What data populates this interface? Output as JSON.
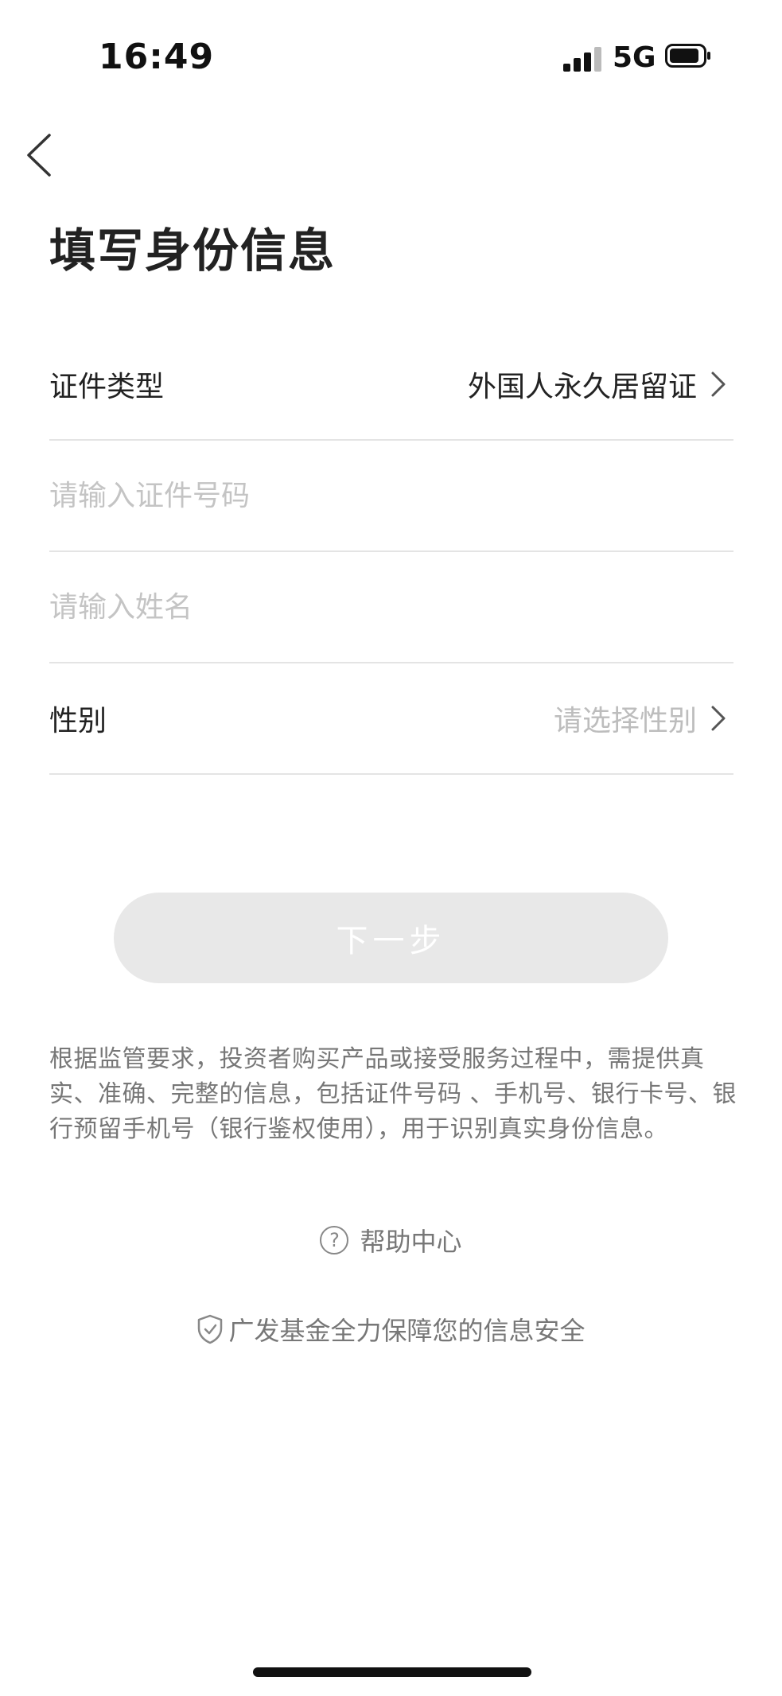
{
  "status_bar": {
    "time": "16:49",
    "network": "5G",
    "signal_icon": "signal-bars-icon",
    "battery_icon": "battery-icon"
  },
  "nav": {
    "back_icon": "chevron-left-icon"
  },
  "page": {
    "title": "填写身份信息"
  },
  "form": {
    "id_type": {
      "label": "证件类型",
      "value": "外国人永久居留证"
    },
    "id_number": {
      "placeholder": "请输入证件号码",
      "value": ""
    },
    "name": {
      "placeholder": "请输入姓名",
      "value": ""
    },
    "gender": {
      "label": "性别",
      "placeholder": "请选择性别"
    }
  },
  "actions": {
    "next_label": "下一步"
  },
  "notice": {
    "text": "根据监管要求，投资者购买产品或接受服务过程中，需提供真实、准确、完整的信息，包括证件号码 、手机号、银行卡号、银行预留手机号（银行鉴权使用），用于识别真实身份信息。"
  },
  "help": {
    "label": "帮助中心",
    "icon": "question-circle-icon"
  },
  "security": {
    "label": "广发基金全力保障您的信息安全",
    "icon": "shield-icon"
  },
  "colors": {
    "button_disabled_bg": "#e8e8e8",
    "placeholder_text": "#bdbdbd",
    "divider": "#e4e4e4",
    "secondary_text": "#777777"
  }
}
